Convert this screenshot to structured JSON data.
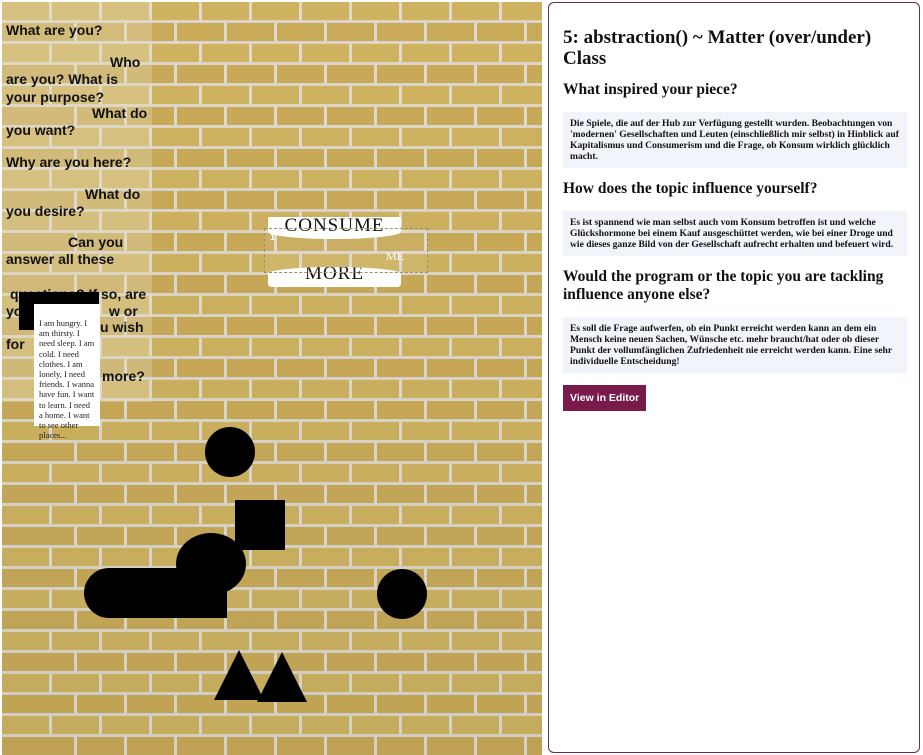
{
  "canvas": {
    "questions": [
      "What are you?",
      "Who",
      "are you? What is",
      "your purpose?",
      "What do",
      "you want?",
      "Why are you here?",
      "What do",
      "you desire?",
      "Can you",
      "answer all these",
      "questions? If so, are",
      "yo",
      "w or",
      "u wish",
      "for",
      "more?"
    ],
    "note_text": "I am hungry. I am thirsty. I need sleep. I am cold. I need clothes. I am lonely, I need friends. I wanna have fun. I want to learn. I need a home. I want to see other places...",
    "sign": {
      "top_word": "CONSUME",
      "bottom_word": "MORE",
      "middle_word": "ME",
      "selection_index": "1"
    }
  },
  "info": {
    "title": "5: abstraction() ~ Matter (over/under) Class",
    "sections": [
      {
        "question": "What inspired your piece?",
        "answer": "Die Spiele, die auf der Hub zur Verfügung gestellt wurden. Beobachtungen von 'modernen' Gesellschaften und Leuten (einschließlich mir selbst) in Hinblick auf Kapitalismus und Consumerism und die Frage, ob Konsum wirklich glücklich macht."
      },
      {
        "question": "How does the topic influence yourself?",
        "answer": "Es ist spannend wie man selbst auch vom Konsum betroffen ist und welche Glückshormone bei einem Kauf ausgeschüttet werden, wie bei einer Droge und wie dieses ganze Bild von der Gesellschaft aufrecht erhalten und befeuert wird."
      },
      {
        "question": "Would the program or the topic you are tackling influence anyone else?",
        "answer": "Es soll die Frage aufwerfen, ob ein Punkt erreicht werden kann an dem ein Mensch keine neuen Sachen, Wünsche etc. mehr braucht/hat oder ob dieser Punkt der vollumfänglichen Zufriedenheit nie erreicht werden kann. Eine sehr individuelle Entscheidung!"
      }
    ],
    "button_label": "View in Editor",
    "accent_color": "#7a1a4a"
  }
}
